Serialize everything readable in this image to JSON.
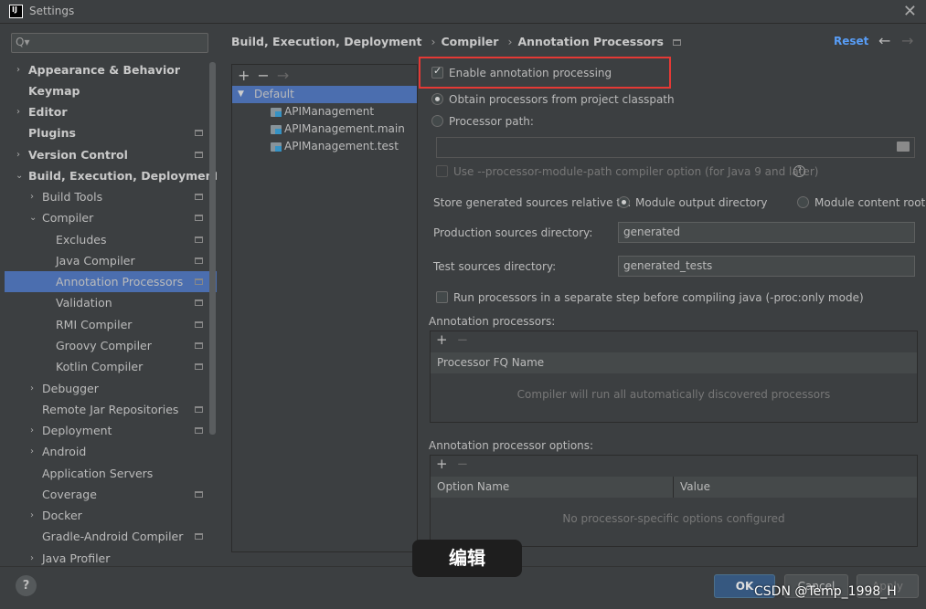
{
  "window": {
    "title": "Settings",
    "app_icon": "IJ"
  },
  "search": {
    "placeholder": "Q▾"
  },
  "sidebar": {
    "items": [
      {
        "label": "Appearance & Behavior",
        "bold": true,
        "arrow": "›"
      },
      {
        "label": "Keymap",
        "bold": true,
        "arrow": ""
      },
      {
        "label": "Editor",
        "bold": true,
        "arrow": "›"
      },
      {
        "label": "Plugins",
        "bold": true,
        "arrow": ""
      },
      {
        "label": "Version Control",
        "bold": true,
        "arrow": "›"
      },
      {
        "label": "Build, Execution, Deployment",
        "bold": true,
        "arrow": "⌄"
      },
      {
        "label": "Build Tools",
        "bold": false,
        "arrow": "›"
      },
      {
        "label": "Compiler",
        "bold": false,
        "arrow": "⌄"
      },
      {
        "label": "Excludes",
        "bold": false,
        "arrow": ""
      },
      {
        "label": "Java Compiler",
        "bold": false,
        "arrow": ""
      },
      {
        "label": "Annotation Processors",
        "bold": false,
        "arrow": "",
        "selected": true
      },
      {
        "label": "Validation",
        "bold": false,
        "arrow": ""
      },
      {
        "label": "RMI Compiler",
        "bold": false,
        "arrow": ""
      },
      {
        "label": "Groovy Compiler",
        "bold": false,
        "arrow": ""
      },
      {
        "label": "Kotlin Compiler",
        "bold": false,
        "arrow": ""
      },
      {
        "label": "Debugger",
        "bold": false,
        "arrow": "›"
      },
      {
        "label": "Remote Jar Repositories",
        "bold": false,
        "arrow": ""
      },
      {
        "label": "Deployment",
        "bold": false,
        "arrow": "›"
      },
      {
        "label": "Android",
        "bold": false,
        "arrow": "›"
      },
      {
        "label": "Application Servers",
        "bold": false,
        "arrow": ""
      },
      {
        "label": "Coverage",
        "bold": false,
        "arrow": ""
      },
      {
        "label": "Docker",
        "bold": false,
        "arrow": "›"
      },
      {
        "label": "Gradle-Android Compiler",
        "bold": false,
        "arrow": ""
      },
      {
        "label": "Java Profiler",
        "bold": false,
        "arrow": "›"
      }
    ]
  },
  "breadcrumb": {
    "items": [
      "Build, Execution, Deployment",
      "Compiler",
      "Annotation Processors"
    ],
    "separator": "›"
  },
  "header": {
    "reset": "Reset",
    "back": "←",
    "forward": "→"
  },
  "profiles": {
    "toolbar": {
      "add": "+",
      "remove": "−",
      "move": "→"
    },
    "items": [
      "Default",
      "APIManagement",
      "APIManagement.main",
      "APIManagement.test"
    ]
  },
  "options": {
    "enable": {
      "label": "Enable annotation processing",
      "checked": true
    },
    "obtain": {
      "label": "Obtain processors from project classpath",
      "selected": true
    },
    "processor_path": {
      "label": "Processor path:",
      "selected": false,
      "value": ""
    },
    "module_path": {
      "label": "Use --processor-module-path compiler option (for Java 9 and later)",
      "checked": false
    },
    "store_label": "Store generated sources relative to:",
    "store_module_output": "Module output directory",
    "store_module_content": "Module content root",
    "production_label": "Production sources directory:",
    "production_value": "generated",
    "test_label": "Test sources directory:",
    "test_value": "generated_tests",
    "separate_step": {
      "label": "Run processors in a separate step before compiling java (-proc:only mode)",
      "checked": false
    }
  },
  "processors_panel": {
    "title": "Annotation processors:",
    "add": "+",
    "remove": "−",
    "column": "Processor FQ Name",
    "empty": "Compiler will run all automatically discovered processors"
  },
  "options_panel": {
    "title": "Annotation processor options:",
    "add": "+",
    "remove": "−",
    "columns": [
      "Option Name",
      "Value"
    ],
    "empty": "No processor-specific options configured"
  },
  "footer": {
    "help": "?",
    "ok": "OK",
    "cancel": "Cancel",
    "apply": "Apply"
  },
  "overlay": {
    "tooltip": "编辑",
    "watermark": "CSDN @Temp_1998_H"
  },
  "colors": {
    "accent": "#4b6eaf",
    "link": "#589df6",
    "highlight_box": "#e53935"
  }
}
